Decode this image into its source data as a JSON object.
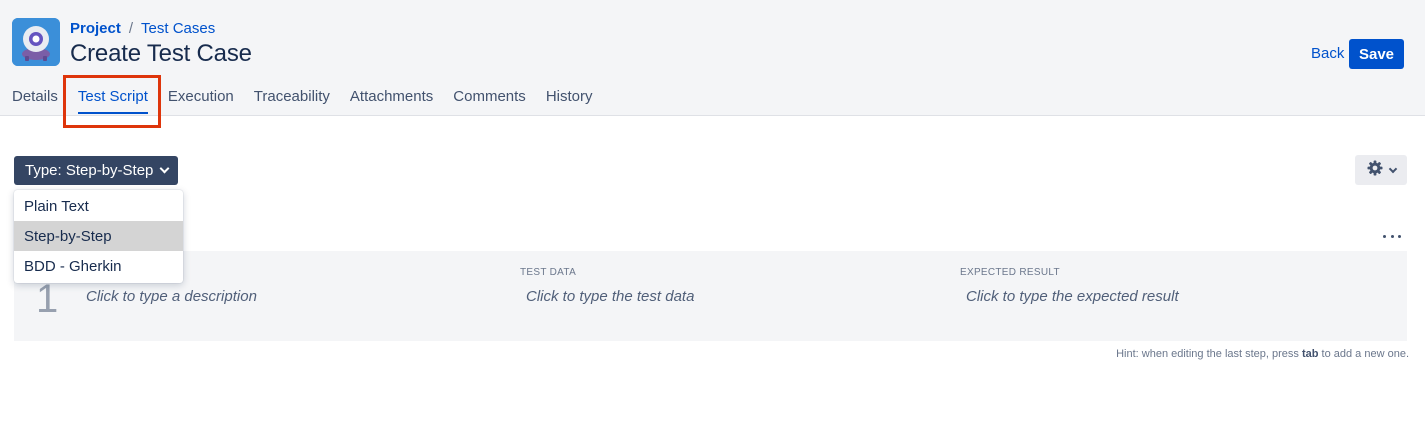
{
  "header": {
    "breadcrumb": {
      "project": "Project",
      "separator": "/",
      "section": "Test Cases"
    },
    "title": "Create Test Case",
    "back_label": "Back",
    "save_label": "Save"
  },
  "tabs": [
    {
      "label": "Details",
      "active": false
    },
    {
      "label": "Test Script",
      "active": true
    },
    {
      "label": "Execution",
      "active": false
    },
    {
      "label": "Traceability",
      "active": false
    },
    {
      "label": "Attachments",
      "active": false
    },
    {
      "label": "Comments",
      "active": false
    },
    {
      "label": "History",
      "active": false
    }
  ],
  "script": {
    "type_button_label": "Type: Step-by-Step",
    "type_options": [
      {
        "label": "Plain Text",
        "selected": false
      },
      {
        "label": "Step-by-Step",
        "selected": true
      },
      {
        "label": "BDD - Gherkin",
        "selected": false
      }
    ],
    "step": {
      "number": "1",
      "description_placeholder": "Click to type a description",
      "test_data_label": "TEST DATA",
      "test_data_placeholder": "Click to type the test data",
      "expected_label": "EXPECTED RESULT",
      "expected_placeholder": "Click to type the expected result"
    },
    "hint_prefix": "Hint: when editing the last step, press ",
    "hint_key": "tab",
    "hint_suffix": " to add a new one."
  },
  "colors": {
    "accent": "#0052cc",
    "highlight": "#de350b",
    "dark_button": "#344563"
  }
}
